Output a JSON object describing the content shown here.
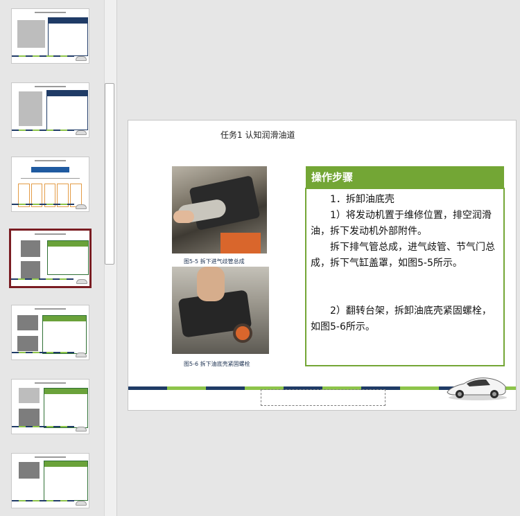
{
  "slide": {
    "title": "任务1    认知润滑油道",
    "caption_1": "图5-5    拆下进气歧管总成",
    "caption_2": "图5-6    拆下油底壳紧固螺栓",
    "steps_header": "操作步骤",
    "steps": [
      "1．拆卸油底壳",
      "1）将发动机置于维修位置，排空润滑油，拆下发动机外部附件。",
      "拆下排气管总成，进气歧管、节气门总成，拆下气缸盖罩，如图5-5所示。",
      "",
      "2）翻转台架，拆卸油底壳紧固螺栓，如图5-6所示。"
    ]
  },
  "thumbnails": {
    "selected_index": 3,
    "count": 7
  },
  "colors": {
    "accent_green": "#73a635",
    "navy": "#1f3b66",
    "light_green": "#8dc44a",
    "selected_border": "#7a1c22"
  },
  "icons": {
    "car_logo": "car-logo-icon"
  }
}
